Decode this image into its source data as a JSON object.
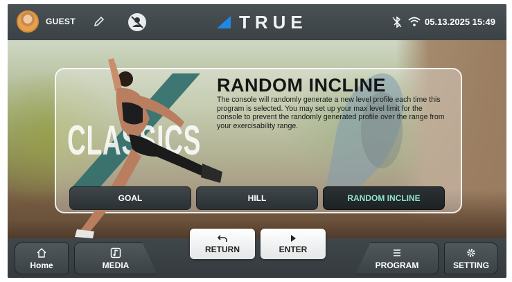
{
  "header": {
    "user_name": "GUEST",
    "brand": "TRUE",
    "datetime": "05.13.2025 15:49"
  },
  "program": {
    "watermark": "CLASSICS",
    "title": "RANDOM INCLINE",
    "description": "The console will randomly generate a new level profile each time this program is selected. You may set up your max level limit for the console to prevent the randomly generated profile over the range from your exercisability range.",
    "modes": [
      {
        "label": "GOAL",
        "active": false
      },
      {
        "label": "HILL",
        "active": false
      },
      {
        "label": "RANDOM INCLINE",
        "active": true
      }
    ]
  },
  "actions": {
    "return_label": "RETURN",
    "enter_label": "ENTER"
  },
  "nav": {
    "home_label": "Home",
    "media_label": "MEDIA",
    "program_label": "PROGRAM",
    "setting_label": "SETTING"
  },
  "colors": {
    "bar": "#3b4246",
    "active_mode_text": "#8fe3cf",
    "logo_accent": "#1e88e5"
  }
}
